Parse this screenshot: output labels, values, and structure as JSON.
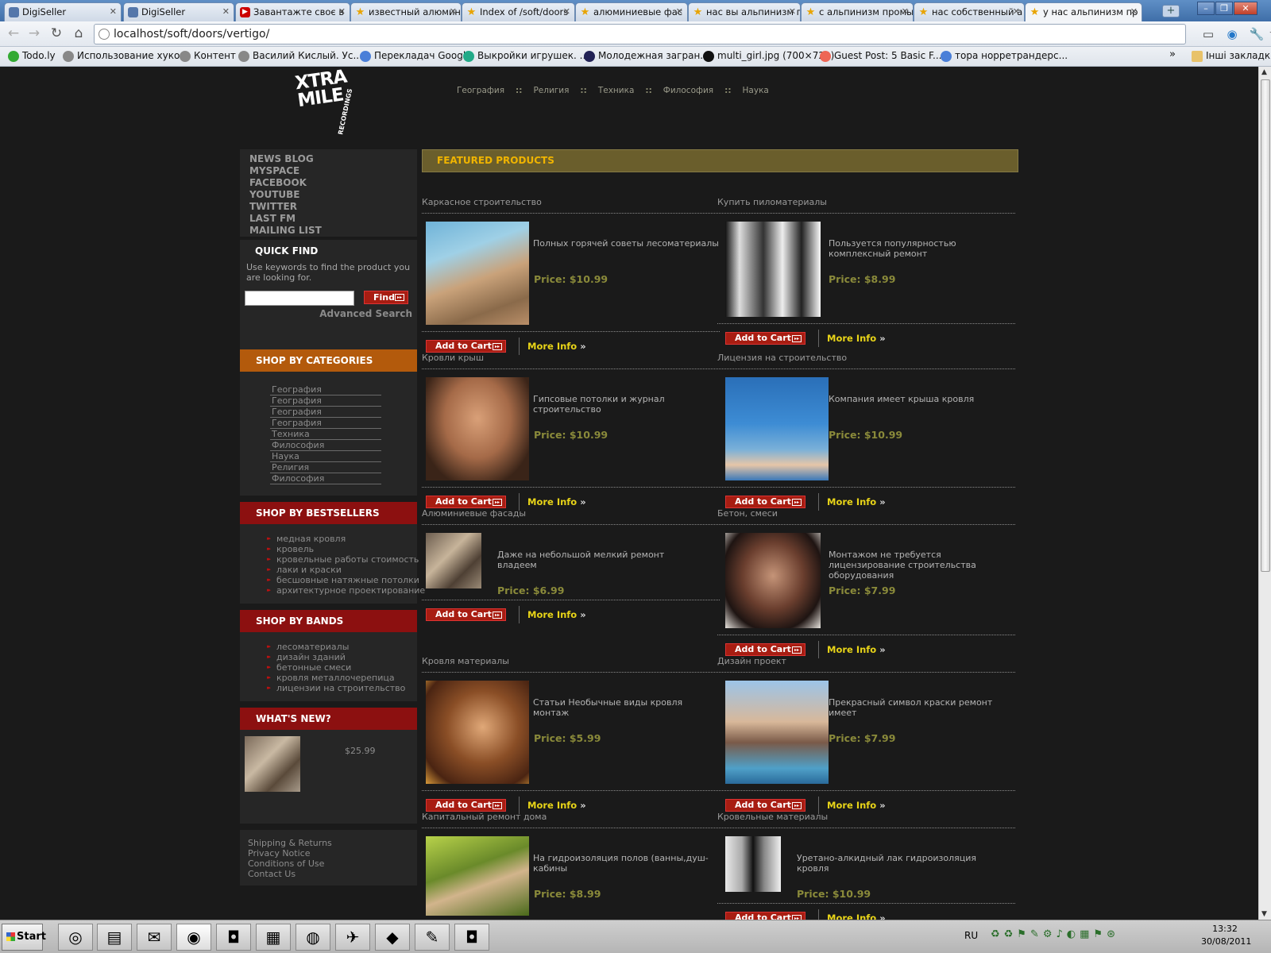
{
  "browser": {
    "tabs": [
      {
        "title": "DigiSeller",
        "icon": "page-icon",
        "color": "#5577aa"
      },
      {
        "title": "DigiSeller",
        "icon": "page-icon",
        "color": "#5577aa"
      },
      {
        "title": "Завантажте своє в",
        "icon": "youtube-icon",
        "color": "#cc0000"
      },
      {
        "title": "известный алюмин",
        "icon": "star-icon",
        "color": "#e8a400"
      },
      {
        "title": "Index of /soft/doors",
        "icon": "star-icon",
        "color": "#e8a400"
      },
      {
        "title": "алюминиевые фас",
        "icon": "star-icon",
        "color": "#e8a400"
      },
      {
        "title": "нас вы альпинизм г",
        "icon": "star-icon",
        "color": "#e8a400"
      },
      {
        "title": "с альпинизм промы",
        "icon": "star-icon",
        "color": "#e8a400"
      },
      {
        "title": "нас собственный а",
        "icon": "star-icon",
        "color": "#e8a400"
      },
      {
        "title": "у нас альпинизм пр",
        "icon": "star-icon",
        "color": "#e8a400",
        "active": true
      }
    ],
    "new_tab_label": "+",
    "url": "localhost/soft/doors/vertigo/",
    "bookmarks": [
      {
        "label": "Todo.ly",
        "icon": "check-icon",
        "color": "#3a3"
      },
      {
        "label": "Использование хуко...",
        "icon": "globe-icon",
        "color": "#888"
      },
      {
        "label": "Контент",
        "icon": "globe-icon",
        "color": "#888"
      },
      {
        "label": "Василий Кислый. Ус...",
        "icon": "globe-icon",
        "color": "#888"
      },
      {
        "label": "Перекладач Google",
        "icon": "translate-icon",
        "color": "#4a7fd8"
      },
      {
        "label": "Выкройки игрушек. ...",
        "icon": "scissors-icon",
        "color": "#2a8"
      },
      {
        "label": "Молодежная загран...",
        "icon": "m-logo-icon",
        "color": "#225"
      },
      {
        "label": "multi_girl.jpg (700×722)",
        "icon": "p-logo-icon",
        "color": "#111"
      },
      {
        "label": "Guest Post: 5 Basic F...",
        "icon": "blogger-icon",
        "color": "#e65"
      },
      {
        "label": "тора норретрандерс...",
        "icon": "google-icon",
        "color": "#4a7fd8"
      }
    ],
    "other_bookmarks": "Інші закладки"
  },
  "site": {
    "logo_text": "XTRA MILE",
    "logo_sub": "RECORDINGS",
    "topnav": [
      "География",
      "Религия",
      "Техника",
      "Философия",
      "Наука"
    ],
    "sidebar_links": [
      "NEWS BLOG",
      "MYSPACE",
      "FACEBOOK",
      "YOUTUBE",
      "TWITTER",
      "LAST FM",
      "MAILING LIST"
    ],
    "quick_find": {
      "title": "QUICK FIND",
      "description": "Use keywords to find the product you are looking for.",
      "button": "Find",
      "advanced": "Advanced Search"
    },
    "categories": {
      "title": "SHOP BY CATEGORIES",
      "items": [
        "География",
        "География",
        "География",
        "География",
        "Техника",
        "Философия",
        "Наука",
        "Религия",
        "Философия"
      ]
    },
    "bestsellers": {
      "title": "SHOP BY BESTSELLERS",
      "items": [
        "медная кровля",
        "кровель",
        "кровельные работы стоимость",
        "лаки и краски",
        "бесшовные натяжные потолки",
        "архитектурное проектирование"
      ]
    },
    "bands": {
      "title": "SHOP BY BANDS",
      "items": [
        "лесоматериалы",
        "дизайн зданий",
        "бетонные смеси",
        "кровля металлочерепица",
        "лицензии на строительство"
      ]
    },
    "whats_new": {
      "title": "WHAT'S NEW?",
      "price": "$25.99"
    },
    "footer_links": [
      "Shipping & Returns",
      "Privacy Notice",
      "Conditions of Use",
      "Contact Us"
    ],
    "featured_title": "FEATURED PRODUCTS",
    "add_to_cart": "Add to Cart",
    "more_info": "More Info",
    "products": [
      {
        "category": "Каркасное строительство",
        "description": "Полных горячей советы лесоматериалы",
        "price": "Price: $10.99"
      },
      {
        "category": "Купить пиломатериалы",
        "description": "Пользуется популярностью комплексный ремонт",
        "price": "Price: $8.99"
      },
      {
        "category": "Кровли крыш",
        "description": "Гипсовые потолки и журнал строительство",
        "price": "Price: $10.99"
      },
      {
        "category": "Лицензия на строительство",
        "description": "Компания имеет крыша кровля",
        "price": "Price: $10.99"
      },
      {
        "category": "Алюминиевые фасады",
        "description": "Даже на небольшой мелкий ремонт владеем",
        "price": "Price: $6.99"
      },
      {
        "category": "Бетон, смеси",
        "description": "Монтажом не требуется лицензирование строительства оборудования",
        "price": "Price: $7.99"
      },
      {
        "category": "Кровля материалы",
        "description": "Статьи Необычные виды кровля монтаж",
        "price": "Price: $5.99"
      },
      {
        "category": "Дизайн проект",
        "description": "Прекрасный символ краски ремонт имеет",
        "price": "Price: $7.99"
      },
      {
        "category": "Капитальный ремонт дома",
        "description": "На гидроизоляция полов (ванны,душ-кабины",
        "price": "Price: $8.99"
      },
      {
        "category": "Кровельные материалы",
        "description": "Уретано-алкидный лак гидроизоляция кровля",
        "price": "Price: $10.99"
      }
    ]
  },
  "taskbar": {
    "start": "Start",
    "apps": [
      "opera-icon",
      "notes-icon",
      "mail-icon",
      "chrome-icon",
      "camera-icon",
      "folder-icon",
      "firefox-icon",
      "messenger-icon",
      "cube-icon",
      "paint-icon",
      "camera-icon"
    ],
    "language": "RU",
    "time": "13:32",
    "date": "30/08/2011"
  }
}
